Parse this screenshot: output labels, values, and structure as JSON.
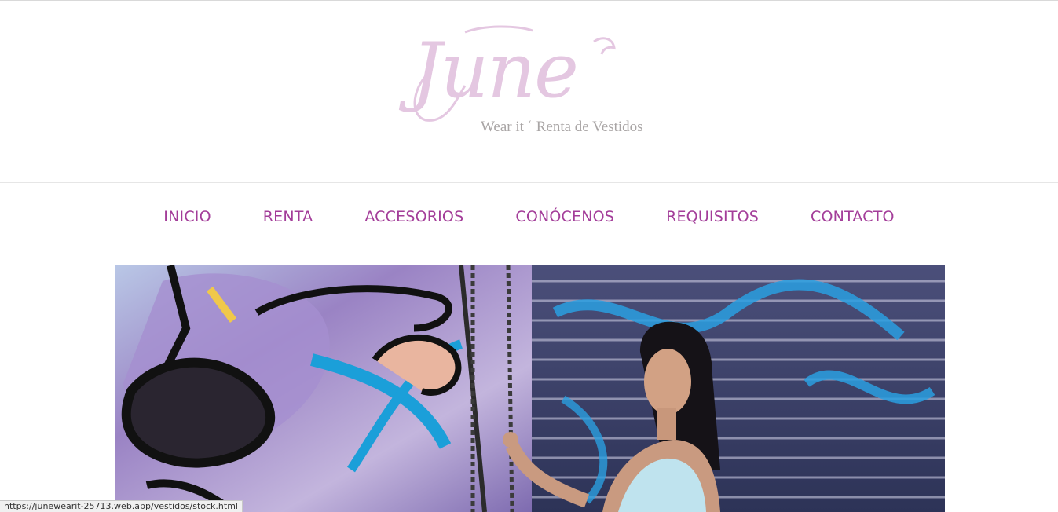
{
  "logo": {
    "wordmark": "June",
    "tagline": "Wear it  ʿ  Renta de Vestidos",
    "color": "#e4c7e1"
  },
  "nav": {
    "color": "#a33d99",
    "items": [
      {
        "label": "INICIO"
      },
      {
        "label": "RENTA"
      },
      {
        "label": "ACCESORIOS"
      },
      {
        "label": "CONÓCENOS"
      },
      {
        "label": "REQUISITOS"
      },
      {
        "label": "CONTACTO"
      }
    ]
  },
  "hero": {
    "alt_subject": "woman-against-graffiti-wall-photo"
  },
  "status_bar": {
    "url": "https://junewearit-25713.web.app/vestidos/stock.html"
  }
}
